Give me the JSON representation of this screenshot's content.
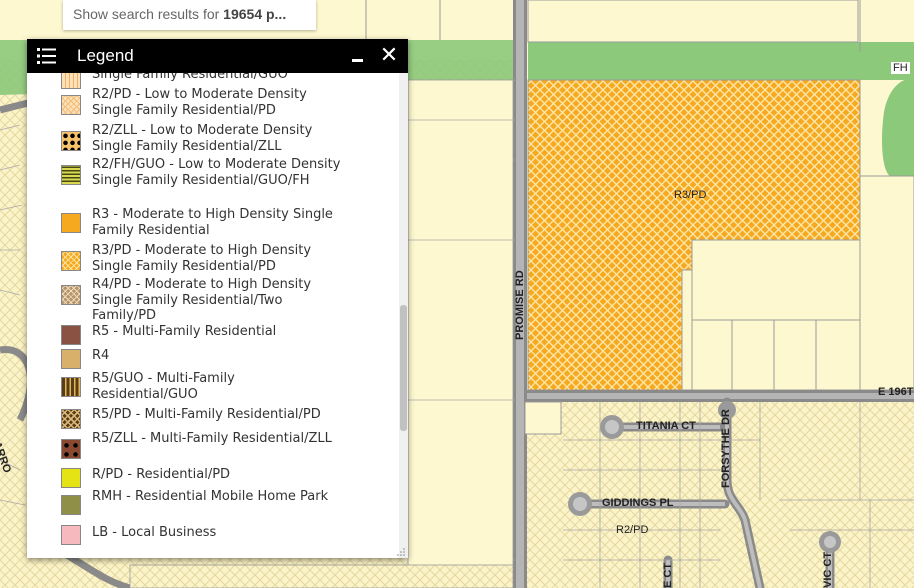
{
  "search": {
    "prefix": "Show search results for ",
    "query": "19654 p..."
  },
  "legend": {
    "title": "Legend",
    "close_glyph": "✕",
    "items": [
      {
        "label": "Single Family Residential/GUO",
        "swatch": "guo-tan"
      },
      {
        "label": "R2/PD - Low to Moderate Density Single Family Residential/PD",
        "swatch": "r2-pd"
      },
      {
        "label": "R2/ZLL - Low to Moderate Density Single Family Residential/ZLL",
        "swatch": "r2-zll"
      },
      {
        "label": "R2/FH/GUO - Low to Moderate Density Single Family Residential/GUO/FH",
        "swatch": "r2-fh-guo"
      },
      {
        "label": "R3 - Moderate to High Density Single Family Residential",
        "swatch": "r3"
      },
      {
        "label": "R3/PD - Moderate to High Density Single Family Residential/PD",
        "swatch": "r3-pd"
      },
      {
        "label": "R4/PD - Moderate to High Density Single Family Residential/Two Family/PD",
        "swatch": "r4-pd"
      },
      {
        "label": "R5 - Multi-Family Residential",
        "swatch": "r5"
      },
      {
        "label": "R4",
        "swatch": "r4"
      },
      {
        "label": "R5/GUO - Multi-Family Residential/GUO",
        "swatch": "r5-guo"
      },
      {
        "label": "R5/PD - Multi-Family Residential/PD",
        "swatch": "r5-pd"
      },
      {
        "label": "R5/ZLL - Multi-Family Residential/ZLL",
        "swatch": "r5-zll"
      },
      {
        "label": "R/PD - Residential/PD",
        "swatch": "r-pd"
      },
      {
        "label": "RMH - Residential Mobile Home Park",
        "swatch": "rmh"
      },
      {
        "label": "LB - Local Business",
        "swatch": "lb"
      }
    ]
  },
  "map": {
    "labels": {
      "zone_r3pd": "R3/PD",
      "zone_r2pd": "R2/PD",
      "promise_rd": "PROMISE RD",
      "titania_ct": "TITANIA CT",
      "forsythe_dr": "FORSYTHE DR",
      "giddings_pl": "GIDDINGS PL",
      "fh": "FH",
      "e196": "E 196T",
      "arrow_cut": "ARRO",
      "vic_ct": "VIC CT",
      "edge_ct": "E CT"
    },
    "colors": {
      "base": "#fdf8d0",
      "r3pd": "#f5a623",
      "floodway": "#8cc97a",
      "road": "#888888"
    }
  }
}
